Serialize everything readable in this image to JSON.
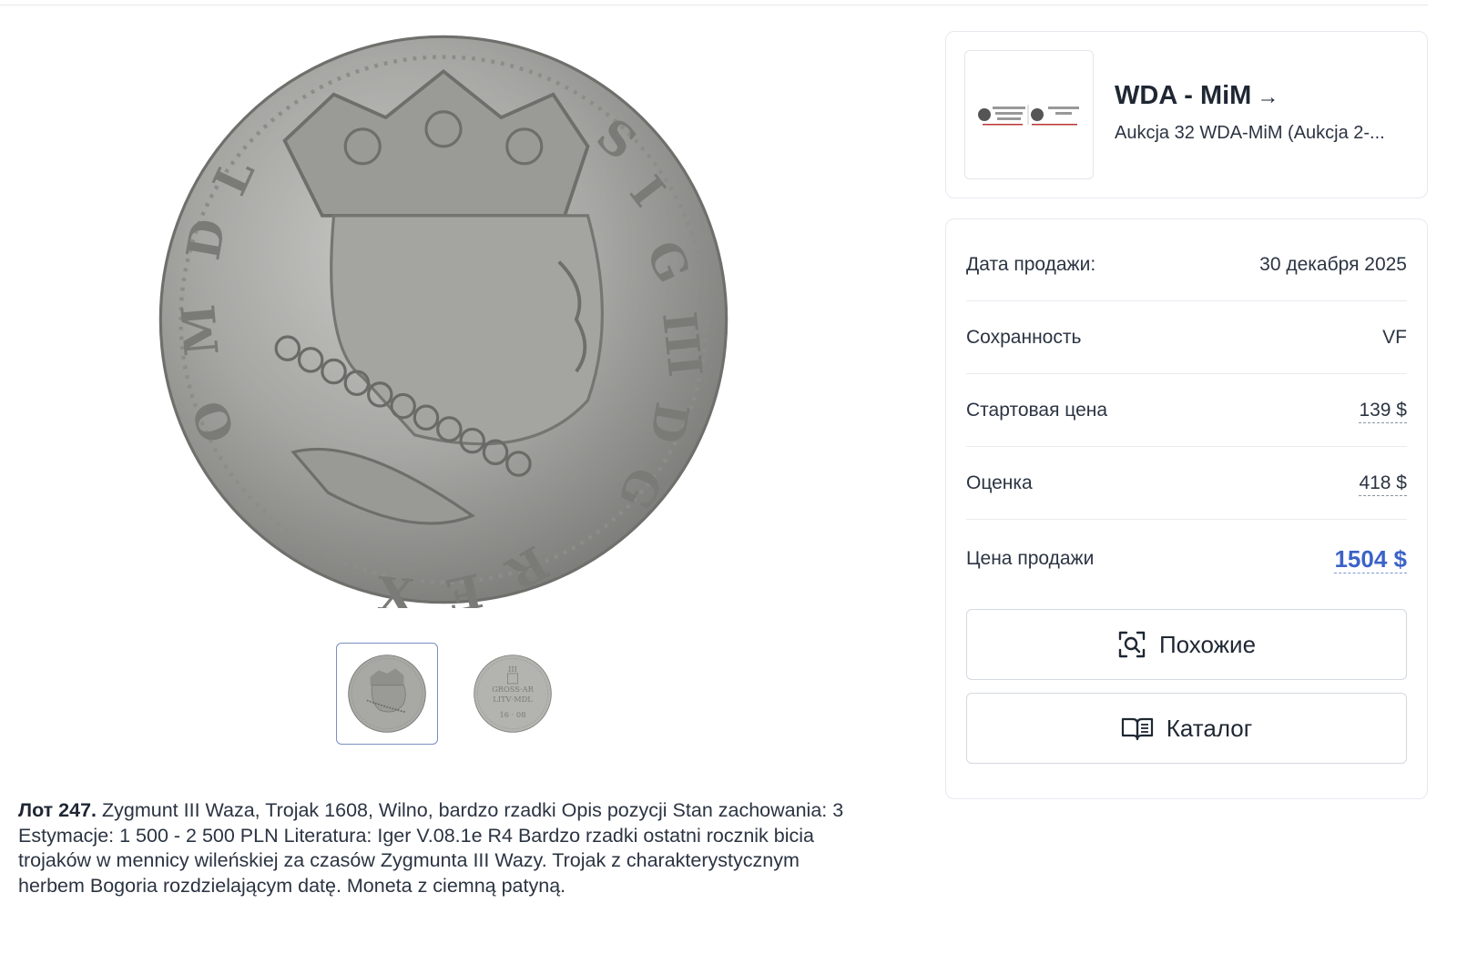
{
  "seller": {
    "name": "WDA - MiM",
    "arrow": "→",
    "auction": "Aukcja 32 WDA-MiM (Aukcja 2-..."
  },
  "details": {
    "rows": [
      {
        "label": "Дата продажи:",
        "value": "30 декабря 2025"
      },
      {
        "label": "Сохранность",
        "value": "VF"
      },
      {
        "label": "Стартовая цена",
        "value": "139 $"
      },
      {
        "label": "Оценка",
        "value": "418 $"
      },
      {
        "label": "Цена продажи",
        "value": "1504 $"
      }
    ]
  },
  "buttons": {
    "similar": {
      "label": "Похожие",
      "icon": "search-scan-icon"
    },
    "catalog": {
      "label": "Каталог",
      "icon": "open-book-icon"
    }
  },
  "lot": {
    "number": "Лот 247.",
    "description": " Zygmunt III Waza, Trojak 1608, Wilno, bardzo rzadki Opis pozycji Stan zachowania: 3 Estymacje: 1 500 - 2 500 PLN Literatura: Iger V.08.1e R4 Bardzo rzadki ostatni rocznik bicia trojaków w mennicy wileńskiej za czasów Zygmunta III Wazy. Trojak z charakterystycznym herbem Bogoria rozdzielającym datę. Moneta z ciemną patyną."
  },
  "images": {
    "main_alt": "obverse-coin-image",
    "thumbnails": [
      "obverse",
      "reverse"
    ]
  },
  "colors": {
    "accent": "#3b63c7",
    "coin": "#a9a9a6",
    "border": "#e6e9ee"
  }
}
